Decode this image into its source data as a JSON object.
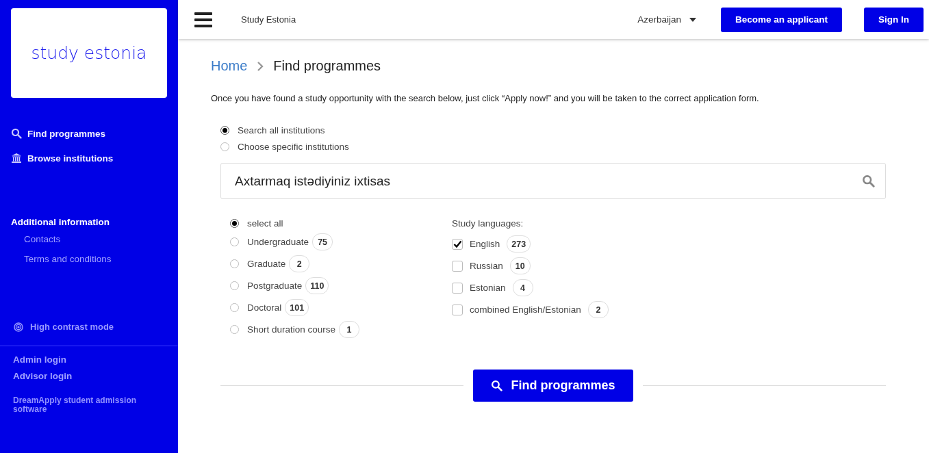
{
  "sidebar": {
    "logo": "study estonia",
    "nav": [
      {
        "label": "Find programmes",
        "kind": "search"
      },
      {
        "label": "Browse institutions",
        "kind": "institution"
      }
    ],
    "section_title": "Additional information",
    "links": [
      "Contacts",
      "Terms and conditions"
    ],
    "contrast": "High contrast mode",
    "logins": [
      "Admin login",
      "Advisor login"
    ],
    "footer": "DreamApply student admission software"
  },
  "topbar": {
    "site": "Study Estonia",
    "country": "Azerbaijan",
    "apply_button": "Become an applicant",
    "signin_button": "Sign In"
  },
  "breadcrumb": [
    "Home",
    "Find programmes"
  ],
  "intro": "Once you have found a study opportunity with the search below, just click “Apply now!” and you will be taken to the correct application form.",
  "scope": [
    {
      "label": "Search all institutions",
      "selected": true
    },
    {
      "label": "Choose specific institutions",
      "selected": false
    }
  ],
  "search": {
    "value": "Axtarmaq istədiyiniz ixtisas"
  },
  "levels": [
    {
      "label": "select all",
      "selected": true
    },
    {
      "label": "Undergraduate",
      "count": "75",
      "selected": false
    },
    {
      "label": "Graduate",
      "count": "2",
      "selected": false
    },
    {
      "label": "Postgraduate",
      "count": "110",
      "selected": false
    },
    {
      "label": "Doctoral",
      "count": "101",
      "selected": false
    },
    {
      "label": "Short duration course",
      "count": "1",
      "selected": false
    }
  ],
  "languages_title": "Study languages:",
  "languages": [
    {
      "label": "English",
      "count": "273",
      "checked": true
    },
    {
      "label": "Russian",
      "count": "10",
      "checked": false
    },
    {
      "label": "Estonian",
      "count": "4",
      "checked": false
    },
    {
      "label": "combined English/Estonian",
      "count": "2",
      "checked": false
    }
  ],
  "find_button": "Find programmes"
}
